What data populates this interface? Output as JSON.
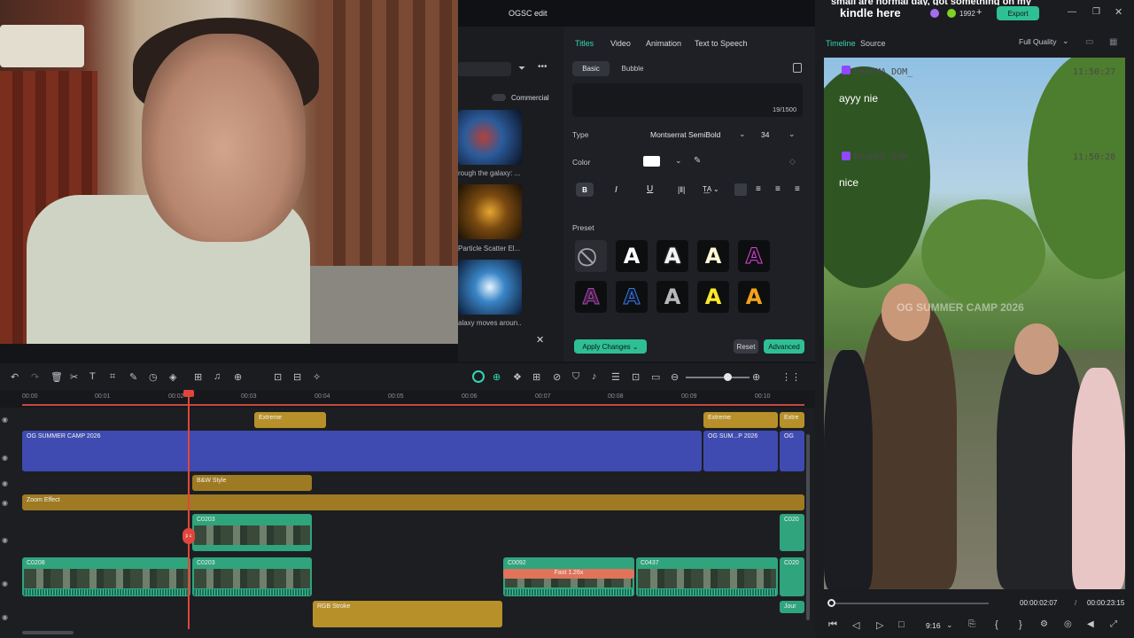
{
  "app": {
    "title": "OGSC edit"
  },
  "header_right": {
    "credits": "1992",
    "export_label": "Export",
    "overlay_caption_partial": "kindle here",
    "overlay_caption_top": "small are normal day, got something on my"
  },
  "media_panel": {
    "commercial_label": "Commercial",
    "items": [
      {
        "caption": "rough the galaxy: ..."
      },
      {
        "caption": "Particle Scatter El..."
      },
      {
        "caption": "alaxy moves aroun..."
      }
    ]
  },
  "titles_panel": {
    "tabs": [
      "Titles",
      "Video",
      "Animation",
      "Text to Speech"
    ],
    "subtabs": [
      "Basic",
      "Bubble"
    ],
    "char_count": "19/1500",
    "type_label": "Type",
    "font": "Montserrat SemiBold",
    "size": "34",
    "color_label": "Color",
    "color_value": "#ffffff",
    "preset_label": "Preset",
    "apply_label": "Apply Changes",
    "reset_label": "Reset",
    "advanced_label": "Advanced"
  },
  "preview": {
    "tabs": [
      "Timeline",
      "Source"
    ],
    "quality": "Full Quality",
    "chat": [
      {
        "user": "DHARMA_DOM_",
        "time": "11:50:27",
        "msg": "ayyy nie"
      },
      {
        "user": "DHARMA_DOM_",
        "time": "11:50:28",
        "msg": "nice"
      }
    ],
    "watermark": "OG SUMMER CAMP 2026",
    "current_time": "00:00:02:07",
    "separator": "/",
    "total_time": "00:00:23:15",
    "ratio": "9:16"
  },
  "timeline": {
    "ruler": [
      "00:00",
      "00:01",
      "00:02",
      "00:03",
      "00:04",
      "00:05",
      "00:06",
      "00:07",
      "00:08",
      "00:09",
      "00:10"
    ],
    "clips": {
      "extreme1": "Extreme",
      "extreme2": "Extreme",
      "extreme3": "Extre",
      "title_main": "OG SUMMER CAMP 2026",
      "title_second": "OG SUM...P 2026",
      "title_third": "OG",
      "bw": "B&W Style",
      "zoom": "Zoom Effect",
      "c0203a": "C0203",
      "c0208": "C0208",
      "c0203b": "C0203",
      "c0092": "C0092",
      "fast": "Fast 1.26x",
      "c0437": "C0437",
      "c020r1": "C020",
      "c020r2": "C020",
      "rgb": "RGB Stroke",
      "jour": "Jour"
    }
  },
  "colors": {
    "accent": "#33d6b3",
    "playhead": "#e0463e",
    "title_track": "#3f4bb0",
    "effect_track": "#b8902a",
    "video_track": "#2fa47d"
  }
}
